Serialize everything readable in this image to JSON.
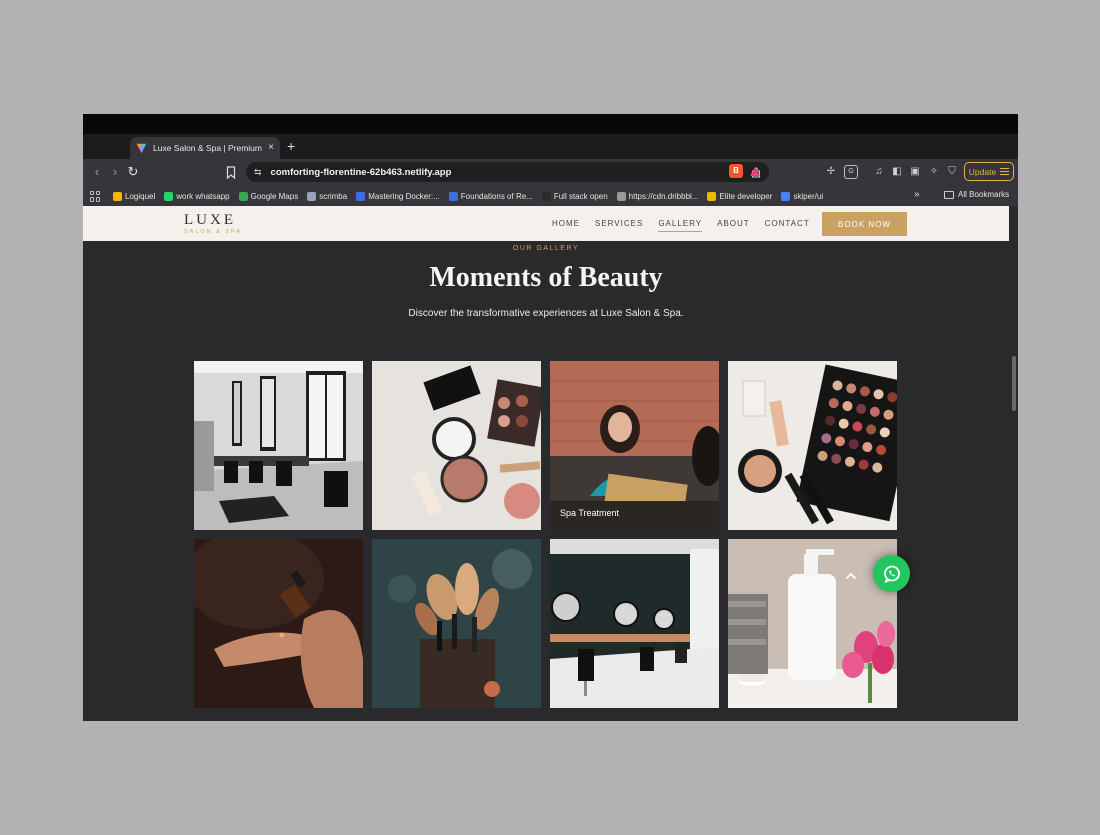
{
  "browser": {
    "tab_title": "Luxe Salon & Spa | Premium Beauty",
    "tab_close": "×",
    "new_tab": "+",
    "url": "comforting-florentine-62b463.netlify.app",
    "update_label": "Update",
    "bookmarks": [
      {
        "label": "Logiquel",
        "color": "#f5b400"
      },
      {
        "label": "work whatsapp",
        "color": "#25d366"
      },
      {
        "label": "Google Maps",
        "color": "#34a853"
      },
      {
        "label": "scrimba",
        "color": "#9aa3b5"
      },
      {
        "label": "Mastering Docker:...",
        "color": "#3b6fe0"
      },
      {
        "label": "Foundations of Re...",
        "color": "#3b6fe0"
      },
      {
        "label": "Full stack open",
        "color": "#2a2a2a"
      },
      {
        "label": "https://cdn.dribbbl...",
        "color": "#9a9a9a"
      },
      {
        "label": "Elite developer",
        "color": "#f5b400"
      },
      {
        "label": "skiper/ui",
        "color": "#4a7dff"
      }
    ],
    "bookmarks_overflow": "»",
    "all_bookmarks": "All Bookmarks"
  },
  "site": {
    "logo": "LUXE",
    "logo_sub": "SALON & SPA",
    "nav": [
      "HOME",
      "SERVICES",
      "GALLERY",
      "ABOUT",
      "CONTACT"
    ],
    "active_nav": "GALLERY",
    "cta": "BOOK NOW",
    "eyebrow": "OUR GALLERY",
    "title": "Moments of Beauty",
    "subtitle": "Discover the transformative experiences at Luxe Salon & Spa.",
    "gallery": [
      {
        "scene": "salon-interior-bw",
        "caption": ""
      },
      {
        "scene": "makeup-flatlay",
        "caption": ""
      },
      {
        "scene": "spa-consultation",
        "caption": "Spa Treatment"
      },
      {
        "scene": "eyeshadow-palette",
        "caption": ""
      },
      {
        "scene": "essential-oil-dropper",
        "caption": ""
      },
      {
        "scene": "makeup-brushes",
        "caption": ""
      },
      {
        "scene": "modern-salon",
        "caption": ""
      },
      {
        "scene": "spa-products",
        "caption": ""
      }
    ],
    "scroll_top_icon": "chevron-up-icon",
    "whatsapp_icon": "whatsapp-icon"
  }
}
